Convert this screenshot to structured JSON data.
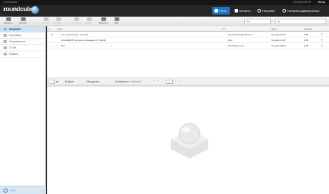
{
  "topline": {
    "about": "О программе",
    "user": "alex@pochta.net",
    "logout": "Выход"
  },
  "header": {
    "logo": "roundcube"
  },
  "nav": {
    "mail": "Почта",
    "contacts": "Контакты",
    "settings": "Настройки",
    "admin": "Настройки администратора"
  },
  "toolbar": {
    "refresh": "Обновить",
    "compose": "Написать",
    "reply": "Ответить",
    "reply_all": "Ответить всем",
    "forward": "Переслать",
    "delete": "Удалить",
    "mark": "Пометить",
    "more": "Ещё",
    "search_scope": "Все",
    "search_placeholder": "Q▾"
  },
  "folders": [
    {
      "label": "Входящие",
      "icon": "inbox-icon",
      "active": true
    },
    {
      "label": "Черновики",
      "icon": "drafts-icon"
    },
    {
      "label": "Отправленные",
      "icon": "sent-icon"
    },
    {
      "label": "СПАМ",
      "icon": "spam-icon"
    },
    {
      "label": "Корзина",
      "icon": "trash-icon"
    }
  ],
  "columns": {
    "subject": "Тема",
    "from": "От",
    "date": "Дата",
    "size": "Размер"
  },
  "messages": [
    {
      "subject": "тест внутренней с почтами",
      "from": "alexandr.inux@pochta.net",
      "date": "Сегодня 02:46",
      "size": "0 КБ"
    },
    {
      "subject": "OnlineEBMS Тестовое сообщение от VVADM",
      "from": "ybyp",
      "date": "Сегодня 11:05",
      "size": "0 КБ"
    },
    {
      "subject": "Тест",
      "from": "Александр слых",
      "date": "Сегодня 00:20",
      "size": "0 КБ"
    }
  ],
  "list_footer": {
    "select": "Выбрать",
    "threads": "Обсуждения",
    "count": "Сообщения с 1 по 3 из 3",
    "page": "1"
  },
  "colors": {
    "accent": "#1e76c2",
    "header_bg": "#262626",
    "active_folder": "#d0e2f2"
  }
}
